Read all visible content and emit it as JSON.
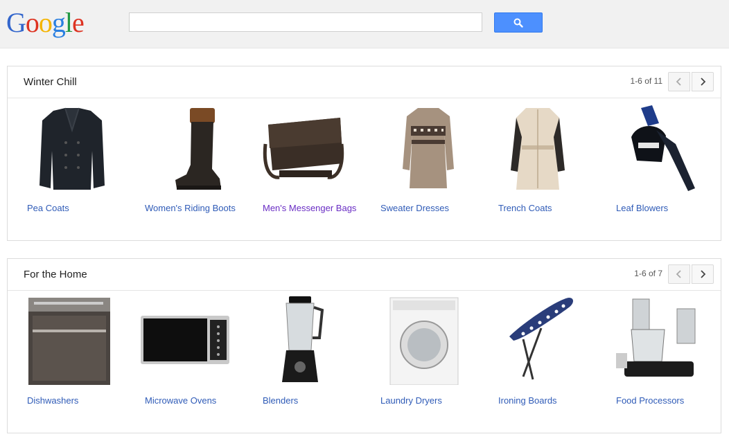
{
  "header": {
    "logo_text": "Google",
    "search": {
      "value": "",
      "placeholder": ""
    },
    "search_button_icon": "search-icon"
  },
  "sections": [
    {
      "title": "Winter Chill",
      "pager": "1-6 of 11",
      "items": [
        {
          "label": "Pea Coats",
          "icon": "pea-coat-image"
        },
        {
          "label": "Women's Riding Boots",
          "icon": "riding-boot-image"
        },
        {
          "label": "Men's Messenger Bags",
          "icon": "messenger-bag-image",
          "visited": true
        },
        {
          "label": "Sweater Dresses",
          "icon": "sweater-dress-image"
        },
        {
          "label": "Trench Coats",
          "icon": "trench-coat-image"
        },
        {
          "label": "Leaf Blowers",
          "icon": "leaf-blower-image"
        }
      ]
    },
    {
      "title": "For the Home",
      "pager": "1-6 of 7",
      "items": [
        {
          "label": "Dishwashers",
          "icon": "dishwasher-image"
        },
        {
          "label": "Microwave Ovens",
          "icon": "microwave-image"
        },
        {
          "label": "Blenders",
          "icon": "blender-image"
        },
        {
          "label": "Laundry Dryers",
          "icon": "dryer-image"
        },
        {
          "label": "Ironing Boards",
          "icon": "ironing-board-image"
        },
        {
          "label": "Food Processors",
          "icon": "food-processor-image"
        }
      ]
    }
  ],
  "colors": {
    "link": "#2f5bb7",
    "visited_link": "#6a2ec4",
    "search_button": "#4d90fe"
  }
}
